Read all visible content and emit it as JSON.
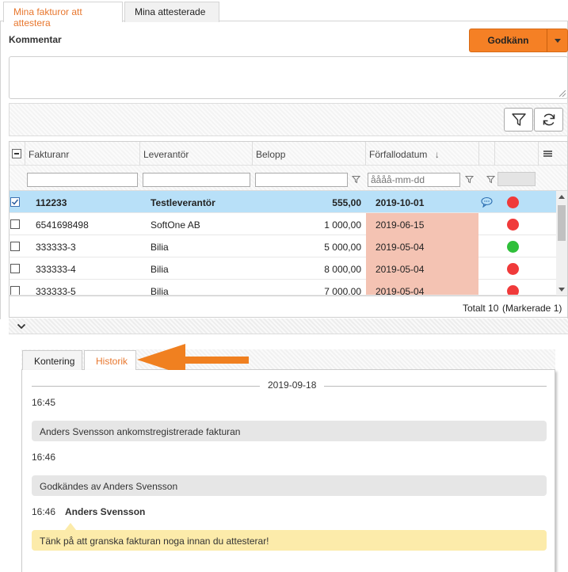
{
  "tabs": [
    {
      "label": "Mina fakturor att attestera",
      "active": true
    },
    {
      "label": "Mina attesterade",
      "active": false
    }
  ],
  "comment": {
    "label": "Kommentar",
    "value": ""
  },
  "approve": {
    "label": "Godkänn",
    "caret_icon": "caret-down-icon"
  },
  "toolbar": {
    "filter_icon": "funnel-icon",
    "refresh_icon": "refresh-icon"
  },
  "grid": {
    "columns": [
      "Fakturanr",
      "Leverantör",
      "Belopp",
      "Förfallodatum"
    ],
    "sort_icon": "arrow-down-icon",
    "menu_icon": "hamburger-icon",
    "date_filter_placeholder": "åååå-mm-dd",
    "rows": [
      {
        "nr": "112233",
        "supplier": "Testleverantör",
        "amount": "555,00",
        "due": "2019-10-01",
        "selected": true,
        "comment_icon": true,
        "status": "red"
      },
      {
        "nr": "6541698498",
        "supplier": "SoftOne AB",
        "amount": "1 000,00",
        "due": "2019-06-15",
        "selected": false,
        "comment_icon": false,
        "status": "red"
      },
      {
        "nr": "333333-3",
        "supplier": "Bilia",
        "amount": "5 000,00",
        "due": "2019-05-04",
        "selected": false,
        "comment_icon": false,
        "status": "green"
      },
      {
        "nr": "333333-4",
        "supplier": "Bilia",
        "amount": "8 000,00",
        "due": "2019-05-04",
        "selected": false,
        "comment_icon": false,
        "status": "red"
      },
      {
        "nr": "333333-5",
        "supplier": "Bilia",
        "amount": "7 000,00",
        "due": "2019-05-04",
        "selected": false,
        "comment_icon": false,
        "status": "red"
      }
    ],
    "footer": {
      "total": "Totalt 10",
      "marked": "(Markerade 1)"
    }
  },
  "lower_tabs": [
    {
      "label": "Kontering",
      "active": false
    },
    {
      "label": "Historik",
      "active": true
    }
  ],
  "history": {
    "date": "2019-09-18",
    "entries": [
      {
        "time": "16:45",
        "message": "Anders Svensson ankomstregistrerade fakturan"
      },
      {
        "time": "16:46",
        "message": "Godkändes av Anders Svensson"
      },
      {
        "time": "16:46",
        "author": "Anders Svensson",
        "note": "Tänk på att granska fakturan noga innan du attesterar!"
      }
    ]
  },
  "colors": {
    "accent": "#e8772e",
    "button": "#f58025",
    "selected_row": "#b8e0f8",
    "overdue": "#f4c3b3",
    "status_red": "#f03a3a",
    "status_green": "#2fbf3a",
    "note": "#fcebaa",
    "arrow": "#f08020"
  }
}
